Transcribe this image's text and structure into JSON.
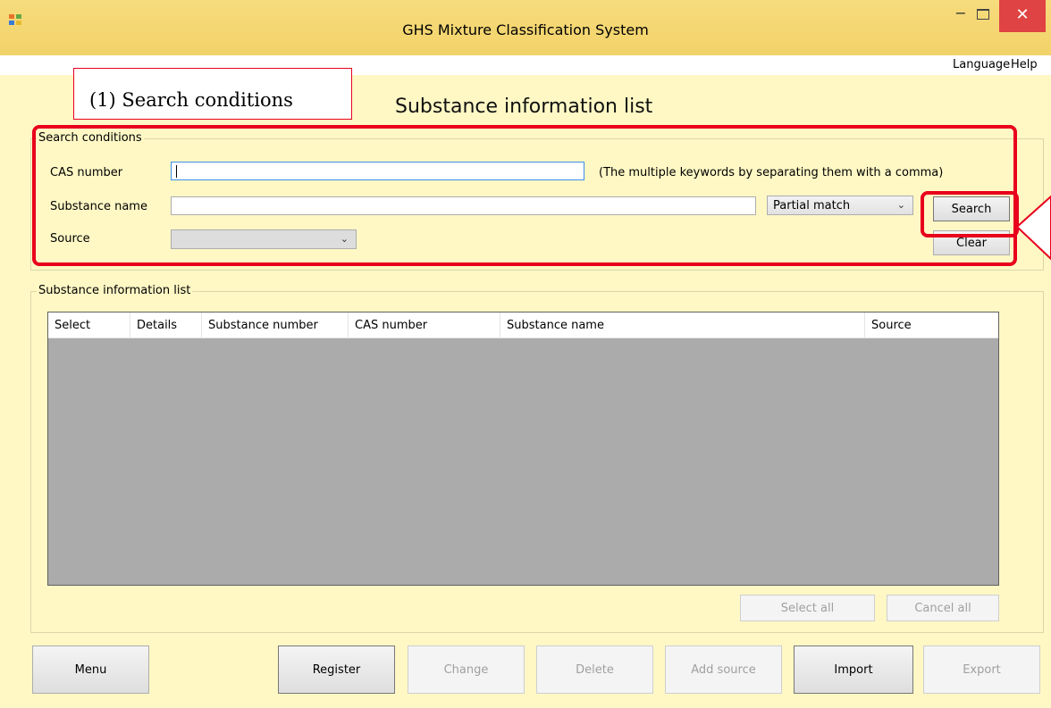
{
  "window": {
    "title": "GHS Mixture Classification System",
    "minimize_glyph": "−",
    "close_glyph": "✕"
  },
  "menu": [
    "Language",
    "Help"
  ],
  "page_title": "Substance information list",
  "annotation": {
    "callout_text": "(1) Search conditions",
    "highlight_color": "#e8001c"
  },
  "search": {
    "group_label": "Search conditions",
    "cas_label": "CAS number",
    "cas_value": "",
    "cas_hint": "(The multiple keywords by separating them with a comma)",
    "name_label": "Substance name",
    "name_value": "",
    "match_mode": "Partial match",
    "source_label": "Source",
    "source_value": "",
    "search_button": "Search",
    "clear_button": "Clear"
  },
  "list": {
    "group_label": "Substance information list",
    "columns": [
      "Select",
      "Details",
      "Substance number",
      "CAS number",
      "Substance name",
      "Source"
    ],
    "rows": [],
    "select_all": "Select all",
    "cancel_all": "Cancel all"
  },
  "footer": {
    "menu": "Menu",
    "register": "Register",
    "change": "Change",
    "delete": "Delete",
    "add_source": "Add source",
    "import": "Import",
    "export": "Export"
  },
  "icons": {
    "app": "app-windows-icon",
    "combo_arrow": "chevron-down-icon"
  },
  "colors": {
    "title_bar": "#f7dc7d",
    "client_bg": "#fff8c5",
    "grid_bg": "#ababab",
    "close_button": "#e04343"
  }
}
